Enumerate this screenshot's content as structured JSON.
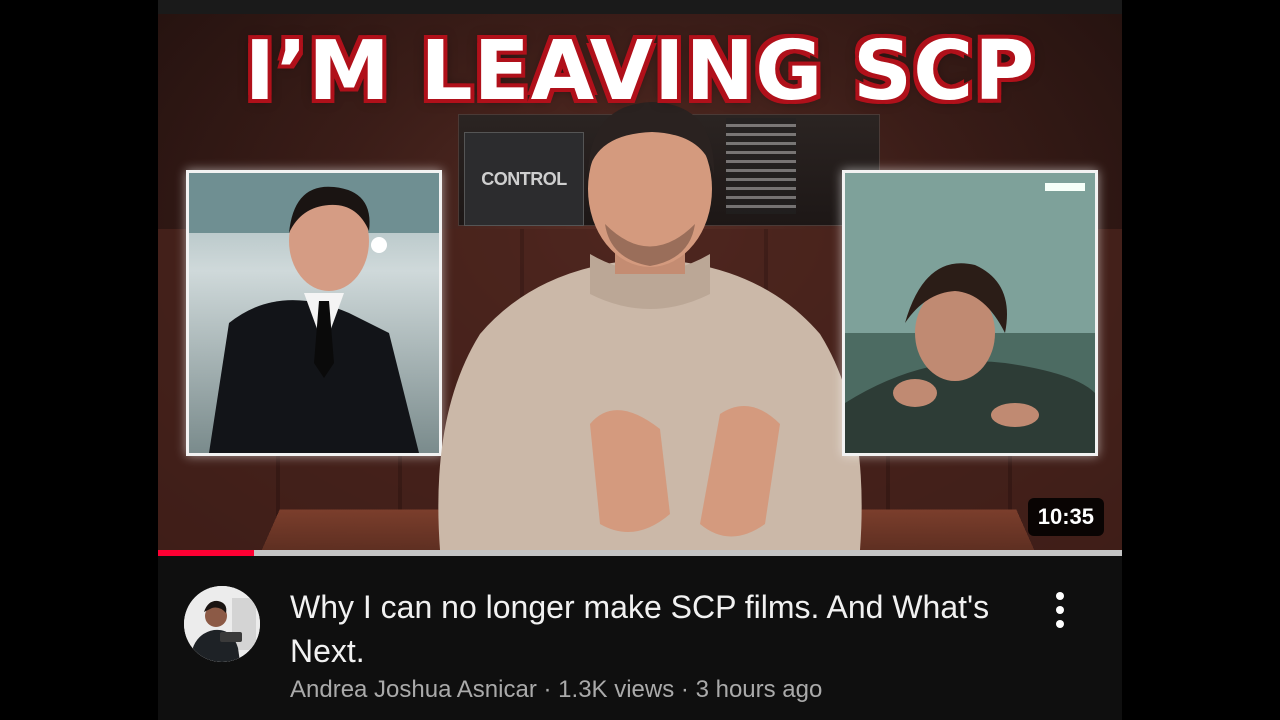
{
  "thumbnail": {
    "overlay_text": "I’M LEAVING SCP",
    "sign_text": "CONTROL",
    "duration": "10:35",
    "watch_progress": 0.1
  },
  "video": {
    "title": "Why I can no longer make SCP films. And What's Next.",
    "channel": "Andrea Joshua Asnicar",
    "views": "1.3K views",
    "age": "3 hours ago",
    "separator": "·"
  },
  "icons": {
    "more": "more-vertical-icon"
  },
  "colors": {
    "background": "#0f0f0f",
    "progress": "#ff0033",
    "title_outline": "#b0101a",
    "meta": "#aaaaaa"
  }
}
